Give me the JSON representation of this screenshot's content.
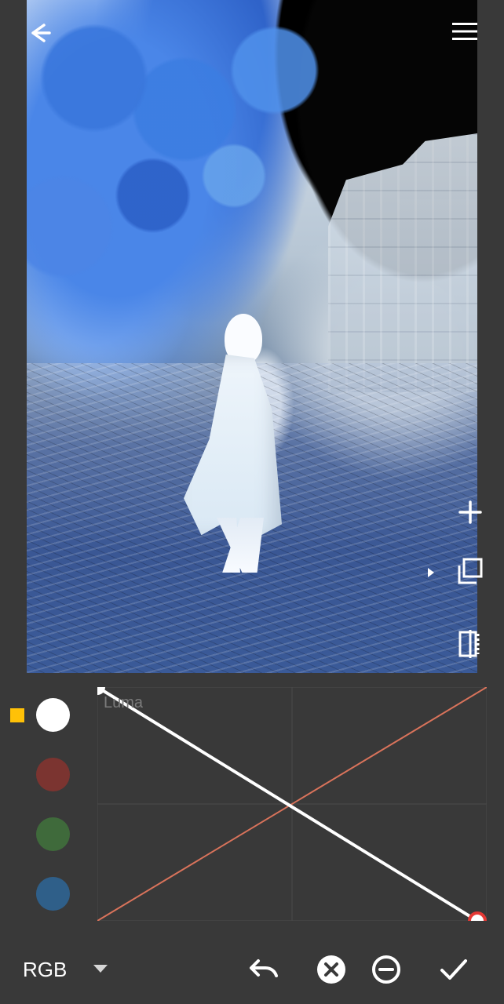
{
  "toolbar": {
    "back_icon": "arrow-left-icon",
    "menu_icon": "hamburger-menu-icon"
  },
  "image": {
    "description_label": ""
  },
  "side_tools": [
    {
      "icon": "plus-icon"
    },
    {
      "icon": "layers-copy-icon"
    },
    {
      "icon": "compare-split-icon"
    }
  ],
  "curves": {
    "channel_label": "Luma",
    "selected_channel_color": "#ffffff",
    "marker_color": "#ffc107"
  },
  "channels": [
    {
      "name": "white",
      "color": "#ffffff"
    },
    {
      "name": "red",
      "color": "#7b3430"
    },
    {
      "name": "green",
      "color": "#3f6a3b"
    },
    {
      "name": "blue",
      "color": "#2f5f89"
    }
  ],
  "bottom_bar": {
    "mode_label": "RGB",
    "dropdown_icon": "triangle-down-icon",
    "undo_icon": "undo-icon",
    "cancel_icon": "x-circle-icon",
    "remove_icon": "minus-circle-icon",
    "apply_icon": "check-icon"
  }
}
